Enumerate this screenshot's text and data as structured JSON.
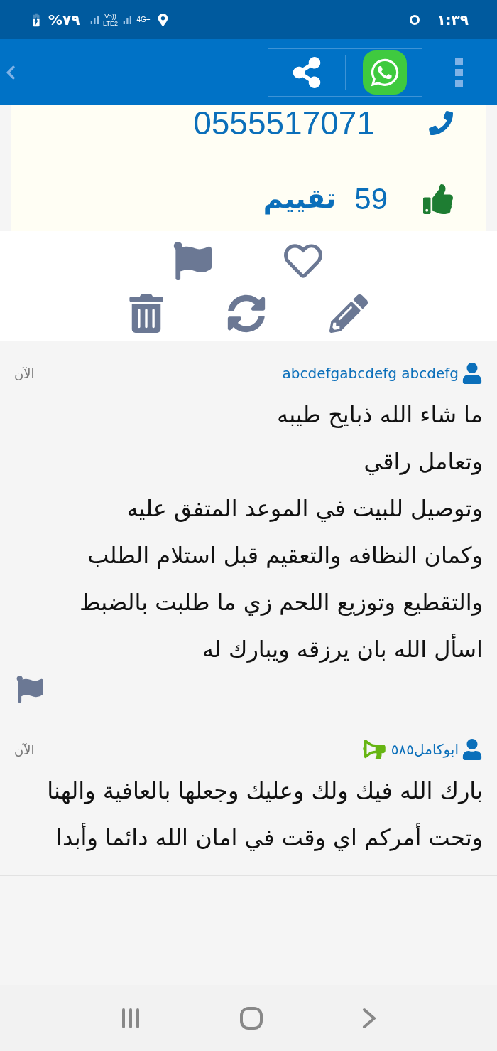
{
  "status_bar": {
    "battery": "%٧٩",
    "network": "Vo)) LTE2",
    "data": "4G+",
    "time": "١:٣٩"
  },
  "contact": {
    "phone": "0555517071",
    "rating_count": "59",
    "rating_label": "تقييم"
  },
  "comments": [
    {
      "author": "abcdefgabcdefg abcdefg",
      "is_advertiser": false,
      "time": "الآن",
      "text": "ما شاء الله ذبايح طيبه\nوتعامل راقي\nوتوصيل للبيت في الموعد المتفق عليه\nوكمان النظافه والتعقيم قبل استلام الطلب\nوالتقطيع وتوزيع اللحم زي ما طلبت بالضبط\nاسأل الله بان يرزقه ويبارك له",
      "reportable": true
    },
    {
      "author": "ابوكامل٥٨٥",
      "is_advertiser": true,
      "time": "الآن",
      "text": "بارك الله فيك ولك وعليك وجعلها بالعافية والهنا وتحت أمركم اي وقت في امان الله دائما وأبدا",
      "reportable": false
    }
  ]
}
